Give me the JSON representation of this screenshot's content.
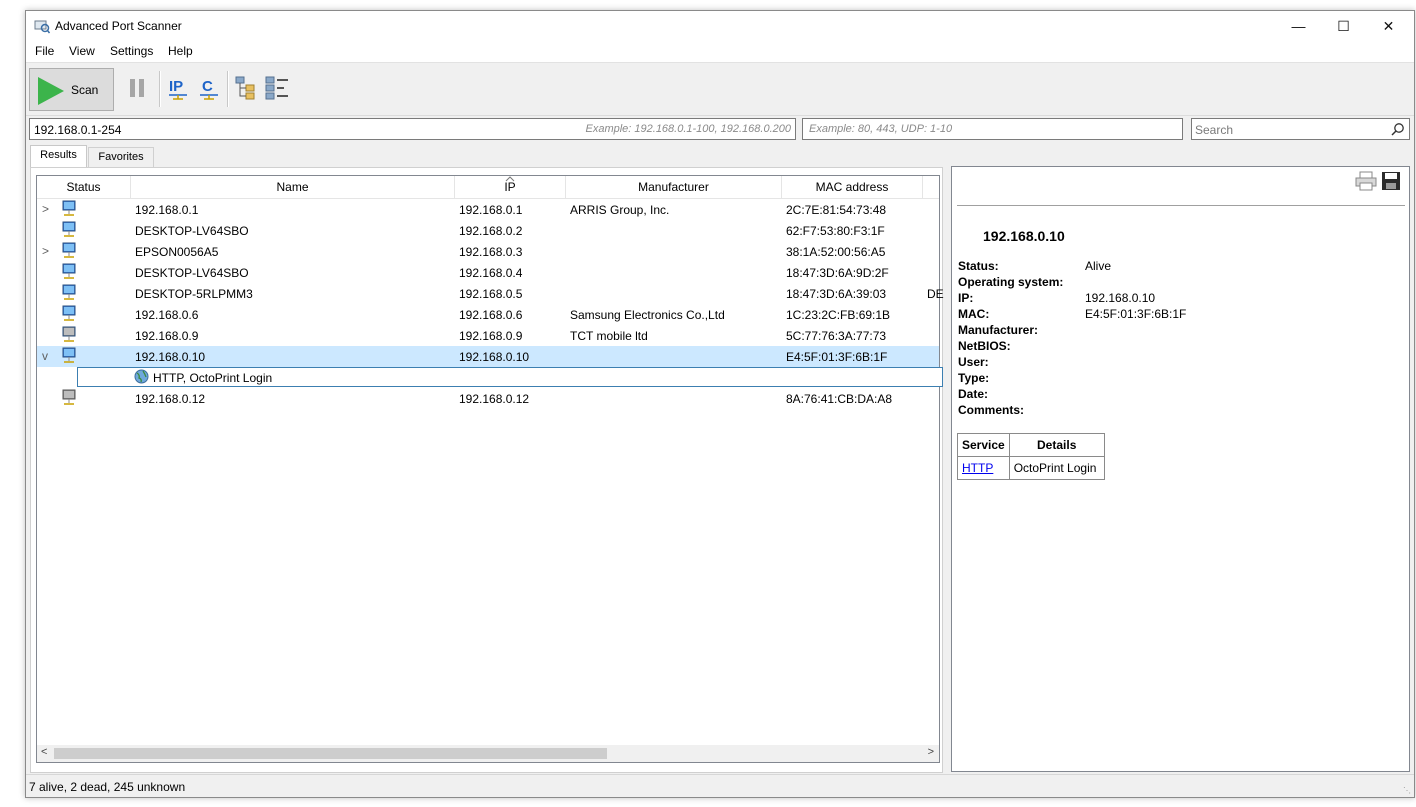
{
  "window": {
    "title": "Advanced Port Scanner"
  },
  "menu": [
    "File",
    "View",
    "Settings",
    "Help"
  ],
  "toolbar": {
    "scan_label": "Scan"
  },
  "inputs": {
    "ip_range_value": "192.168.0.1-254",
    "ip_range_hint": "Example: 192.168.0.1-100, 192.168.0.200",
    "ports_hint": "Example: 80, 443, UDP: 1-10",
    "search_placeholder": "Search"
  },
  "tabs": [
    "Results",
    "Favorites"
  ],
  "columns": [
    "Status",
    "Name",
    "IP",
    "Manufacturer",
    "MAC address"
  ],
  "rows": [
    {
      "expander": ">",
      "name": "192.168.0.1",
      "ip": "192.168.0.1",
      "manufacturer": "ARRIS Group, Inc.",
      "mac": "2C:7E:81:54:73:48",
      "extra": ""
    },
    {
      "expander": "",
      "name": "DESKTOP-LV64SBO",
      "ip": "192.168.0.2",
      "manufacturer": "",
      "mac": "62:F7:53:80:F3:1F",
      "extra": ""
    },
    {
      "expander": ">",
      "name": "EPSON0056A5",
      "ip": "192.168.0.3",
      "manufacturer": "",
      "mac": "38:1A:52:00:56:A5",
      "extra": ""
    },
    {
      "expander": "",
      "name": "DESKTOP-LV64SBO",
      "ip": "192.168.0.4",
      "manufacturer": "",
      "mac": "18:47:3D:6A:9D:2F",
      "extra": ""
    },
    {
      "expander": "",
      "name": "DESKTOP-5RLPMM3",
      "ip": "192.168.0.5",
      "manufacturer": "",
      "mac": "18:47:3D:6A:39:03",
      "extra": "DE"
    },
    {
      "expander": "",
      "name": "192.168.0.6",
      "ip": "192.168.0.6",
      "manufacturer": "Samsung Electronics Co.,Ltd",
      "mac": "1C:23:2C:FB:69:1B",
      "extra": ""
    },
    {
      "expander": "",
      "name": "192.168.0.9",
      "ip": "192.168.0.9",
      "manufacturer": "TCT mobile ltd",
      "mac": "5C:77:76:3A:77:73",
      "extra": ""
    },
    {
      "expander": "v",
      "name": "192.168.0.10",
      "ip": "192.168.0.10",
      "manufacturer": "",
      "mac": "E4:5F:01:3F:6B:1F",
      "extra": ""
    }
  ],
  "service_row": {
    "label": "HTTP, OctoPrint Login"
  },
  "last_row": {
    "name": "192.168.0.12",
    "ip": "192.168.0.12",
    "mac": "8A:76:41:CB:DA:A8"
  },
  "details": {
    "ip": "192.168.0.10",
    "labels": [
      "Status:",
      "Operating system:",
      "IP:",
      "MAC:",
      "Manufacturer:",
      "NetBIOS:",
      "User:",
      "Type:",
      "Date:",
      "Comments:"
    ],
    "values": [
      "Alive",
      "",
      "192.168.0.10",
      "E4:5F:01:3F:6B:1F",
      "",
      "",
      "",
      "",
      "",
      ""
    ],
    "service_header": "Service",
    "details_header": "Details",
    "service_link": "HTTP",
    "service_details": "OctoPrint Login"
  },
  "statusbar": {
    "text": "7 alive, 2 dead, 245 unknown"
  },
  "colors": {
    "selection": "#cce8ff",
    "scan_green": "#3cb44b",
    "link": "#0000ee",
    "toolbar_blue": "#1e64c8"
  }
}
